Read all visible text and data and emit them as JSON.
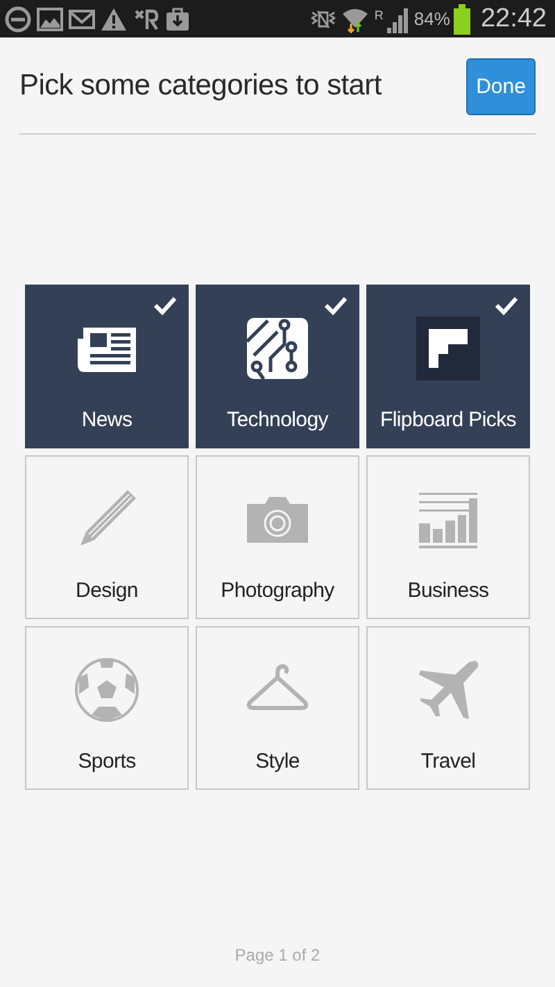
{
  "status_bar": {
    "network_label": "R",
    "battery": "84%",
    "time": "22:42"
  },
  "header": {
    "title": "Pick some categories to start",
    "done_button": "Done"
  },
  "categories": [
    {
      "label": "News",
      "selected": true
    },
    {
      "label": "Technology",
      "selected": true
    },
    {
      "label": "Flipboard Picks",
      "selected": true
    },
    {
      "label": "Design",
      "selected": false
    },
    {
      "label": "Photography",
      "selected": false
    },
    {
      "label": "Business",
      "selected": false
    },
    {
      "label": "Sports",
      "selected": false
    },
    {
      "label": "Style",
      "selected": false
    },
    {
      "label": "Travel",
      "selected": false
    }
  ],
  "pager": "Page 1 of 2"
}
